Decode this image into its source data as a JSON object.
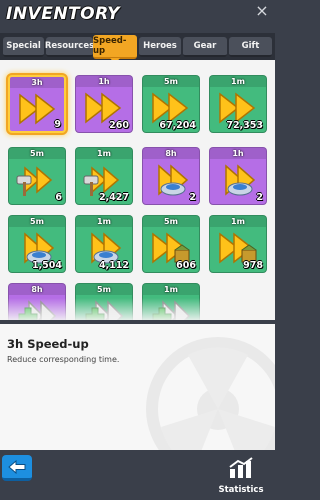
{
  "header": {
    "title": "INVENTORY",
    "close": "×"
  },
  "tabs": [
    {
      "label": "Special",
      "active": false
    },
    {
      "label": "Resources",
      "active": false
    },
    {
      "label": "Speed-up",
      "active": true
    },
    {
      "label": "Heroes",
      "active": false
    },
    {
      "label": "Gear",
      "active": false
    },
    {
      "label": "Gift",
      "active": false
    }
  ],
  "colors": {
    "purple_tile": "#b56ee6",
    "green_tile": "#43bb7e",
    "accent": "#f2a623",
    "arrow": "#ffc21a"
  },
  "items": [
    {
      "duration": "3h",
      "quantity": "9",
      "color": "purple",
      "icon": "double-arrow-icon",
      "selected": true
    },
    {
      "duration": "1h",
      "quantity": "260",
      "color": "purple",
      "icon": "double-arrow-icon"
    },
    {
      "duration": "5m",
      "quantity": "67,204",
      "color": "green",
      "icon": "double-arrow-icon"
    },
    {
      "duration": "1m",
      "quantity": "72,353",
      "color": "green",
      "icon": "double-arrow-icon"
    },
    {
      "duration": "5m",
      "quantity": "6",
      "color": "green",
      "icon": "hammer-icon"
    },
    {
      "duration": "1m",
      "quantity": "2,427",
      "color": "green",
      "icon": "hammer-icon"
    },
    {
      "duration": "8h",
      "quantity": "2",
      "color": "purple",
      "icon": "flask-icon"
    },
    {
      "duration": "1h",
      "quantity": "2",
      "color": "purple",
      "icon": "flask-icon"
    },
    {
      "duration": "5m",
      "quantity": "1,504",
      "color": "green",
      "icon": "flask-icon"
    },
    {
      "duration": "1m",
      "quantity": "4,112",
      "color": "green",
      "icon": "flask-icon"
    },
    {
      "duration": "5m",
      "quantity": "606",
      "color": "green",
      "icon": "training-icon"
    },
    {
      "duration": "1m",
      "quantity": "978",
      "color": "green",
      "icon": "training-icon"
    },
    {
      "duration": "8h",
      "quantity": "",
      "color": "purple",
      "icon": "healing-icon"
    },
    {
      "duration": "5m",
      "quantity": "",
      "color": "green",
      "icon": "healing-icon"
    },
    {
      "duration": "1m",
      "quantity": "",
      "color": "green",
      "icon": "healing-icon"
    }
  ],
  "detail": {
    "title": "3h Speed-up",
    "description": "Reduce corresponding time."
  },
  "footer": {
    "statistics_label": "Statistics"
  }
}
